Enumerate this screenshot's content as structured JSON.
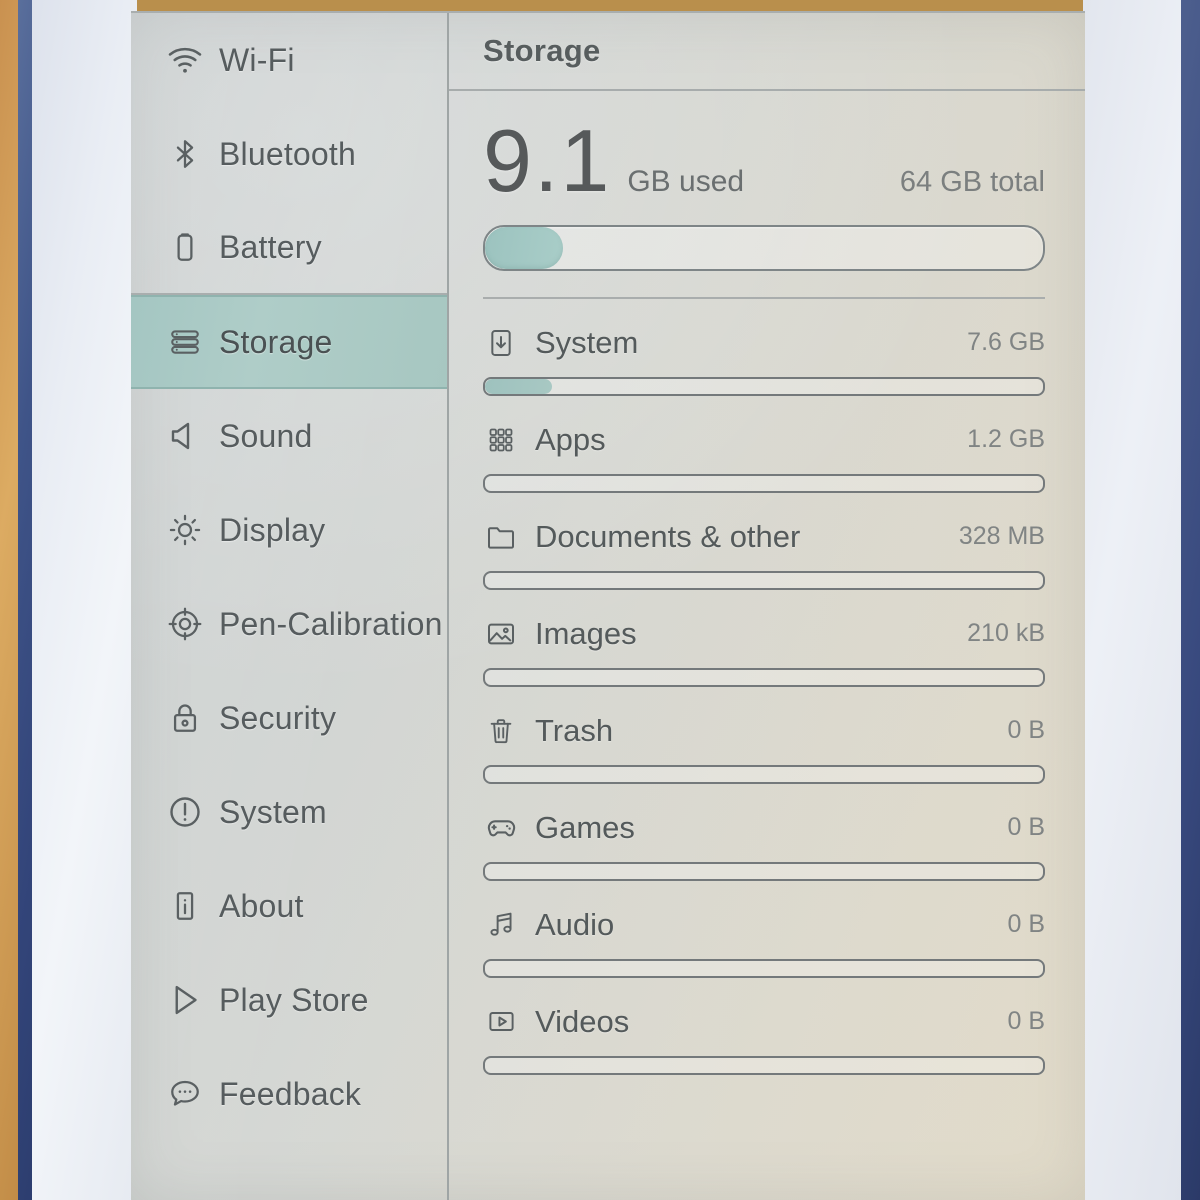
{
  "device": {
    "screen_title": "Storage"
  },
  "sidebar": {
    "items": [
      {
        "label": "Wi-Fi",
        "icon": "wifi-icon",
        "selected": false
      },
      {
        "label": "Bluetooth",
        "icon": "bluetooth-icon",
        "selected": false
      },
      {
        "label": "Battery",
        "icon": "battery-icon",
        "selected": false
      },
      {
        "label": "Storage",
        "icon": "storage-icon",
        "selected": true
      },
      {
        "label": "Sound",
        "icon": "speaker-icon",
        "selected": false
      },
      {
        "label": "Display",
        "icon": "brightness-sun-icon",
        "selected": false
      },
      {
        "label": "Pen-Calibration",
        "icon": "crosshair-icon",
        "selected": false
      },
      {
        "label": "Security",
        "icon": "lock-icon",
        "selected": false
      },
      {
        "label": "System",
        "icon": "exclamation-circle-icon",
        "selected": false
      },
      {
        "label": "About",
        "icon": "info-icon",
        "selected": false
      },
      {
        "label": "Play Store",
        "icon": "play-triangle-icon",
        "selected": false
      },
      {
        "label": "Feedback",
        "icon": "chat-bubble-icon",
        "selected": false
      }
    ]
  },
  "main": {
    "title": "Storage",
    "used_value": "9.1",
    "used_unit": "GB used",
    "total_label": "64 GB total",
    "used_percent": 14,
    "categories": [
      {
        "label": "System",
        "size": "7.6 GB",
        "icon": "download-box-icon",
        "percent": 12
      },
      {
        "label": "Apps",
        "size": "1.2 GB",
        "icon": "apps-grid-icon",
        "percent": 0
      },
      {
        "label": "Documents & other",
        "size": "328 MB",
        "icon": "folder-icon",
        "percent": 0
      },
      {
        "label": "Images",
        "size": "210 kB",
        "icon": "image-icon",
        "percent": 0
      },
      {
        "label": "Trash",
        "size": "0 B",
        "icon": "trash-icon",
        "percent": 0
      },
      {
        "label": "Games",
        "size": "0 B",
        "icon": "gamepad-icon",
        "percent": 0
      },
      {
        "label": "Audio",
        "size": "0 B",
        "icon": "music-note-icon",
        "percent": 0
      },
      {
        "label": "Videos",
        "size": "0 B",
        "icon": "video-play-icon",
        "percent": 0
      }
    ]
  },
  "colors": {
    "accent_teal": "#a9cdc8",
    "screen_bg": "#d6d8d4",
    "text": "#545a5b",
    "muted_text": "#808484",
    "bezel": "#e9edf4",
    "case_edge": "#33457a"
  }
}
